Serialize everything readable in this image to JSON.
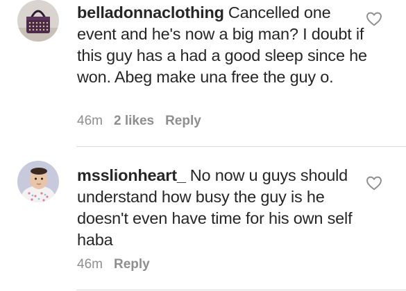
{
  "comments": [
    {
      "username": "belladonnaclothing",
      "text": "Cancelled one event and he's now a big man? I doubt if this guy has a had a good sleep since he won. Abeg make una free the guy o.",
      "time": "46m",
      "likes": "2 likes",
      "reply_label": "Reply",
      "avatar": "handbag-photo"
    },
    {
      "username": "msslionheart_",
      "text": "No now u guys should understand how busy the guy is he doesn't even have time for his own self haba",
      "time": "46m",
      "reply_label": "Reply",
      "avatar": "baby-photo"
    }
  ],
  "icons": {
    "like": "heart-outline-icon"
  },
  "colors": {
    "text": "#262626",
    "meta": "#8e8e8e",
    "divider": "#dbdbdb"
  }
}
